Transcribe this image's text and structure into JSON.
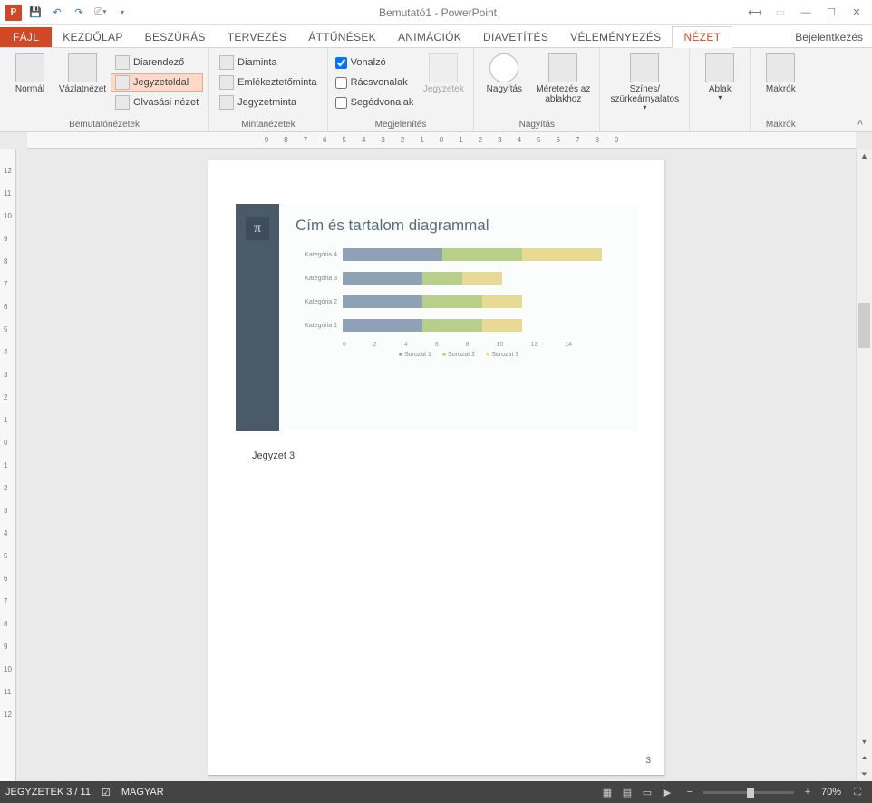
{
  "title": "Bemutató1 - PowerPoint",
  "signin": "Bejelentkezés",
  "tabs": {
    "file": "FÁJL",
    "home": "KEZDŐLAP",
    "insert": "BESZÚRÁS",
    "design": "TERVEZÉS",
    "transitions": "ÁTTŰNÉSEK",
    "animations": "ANIMÁCIÓK",
    "slideshow": "DIAVETÍTÉS",
    "review": "VÉLEMÉNYEZÉS",
    "view": "NÉZET"
  },
  "ribbon": {
    "presentation_views": {
      "label": "Bemutatónézetek",
      "normal": "Normál",
      "outline": "Vázlatnézet",
      "sorter": "Diarendező",
      "notes": "Jegyzetoldal",
      "reading": "Olvasási nézet"
    },
    "master_views": {
      "label": "Mintanézetek",
      "slide_master": "Diaminta",
      "handout_master": "Emlékeztetőminta",
      "notes_master": "Jegyzetminta"
    },
    "show": {
      "label": "Megjelenítés",
      "ruler": "Vonalzó",
      "gridlines": "Rácsvonalak",
      "guides": "Segédvonalak",
      "notes": "Jegyzetek"
    },
    "zoom": {
      "label": "Nagyítás",
      "zoom": "Nagyítás",
      "fit": "Méretezés az ablakhoz"
    },
    "color": {
      "label": "Színes/ szürkeárnyalatos"
    },
    "window": {
      "label": "Ablak"
    },
    "macros": {
      "label_top": "Makrók",
      "label": "Makrók"
    }
  },
  "ruler_h": [
    "9",
    "8",
    "7",
    "6",
    "5",
    "4",
    "3",
    "2",
    "1",
    "0",
    "1",
    "2",
    "3",
    "4",
    "5",
    "6",
    "7",
    "8",
    "9"
  ],
  "ruler_v": [
    "12",
    "11",
    "10",
    "9",
    "8",
    "7",
    "6",
    "5",
    "4",
    "3",
    "2",
    "1",
    "0",
    "1",
    "2",
    "3",
    "4",
    "5",
    "6",
    "7",
    "8",
    "9",
    "10",
    "11",
    "12"
  ],
  "slide": {
    "pi": "π",
    "title": "Cím és tartalom diagrammal",
    "notes": "Jegyzet 3",
    "page_number": "3"
  },
  "chart_data": {
    "type": "bar",
    "orientation": "horizontal",
    "stacked": true,
    "categories": [
      "Kategória 4",
      "Kategória 3",
      "Kategória 2",
      "Kategória 1"
    ],
    "series": [
      {
        "name": "Sorozat 1",
        "values": [
          5,
          4,
          4,
          4
        ]
      },
      {
        "name": "Sorozat 2",
        "values": [
          4,
          2,
          3,
          3
        ]
      },
      {
        "name": "Sorozat 3",
        "values": [
          4,
          2,
          2,
          2
        ]
      }
    ],
    "xlabel": "",
    "ylabel": "",
    "xlim": [
      0,
      14
    ],
    "x_ticks": [
      0,
      2,
      4,
      6,
      8,
      10,
      12,
      14
    ],
    "legend": [
      "Sorozat 1",
      "Sorozat 2",
      "Sorozat 3"
    ]
  },
  "status": {
    "page": "JEGYZETEK 3 / 11",
    "lang": "MAGYAR",
    "zoom": "70%"
  }
}
